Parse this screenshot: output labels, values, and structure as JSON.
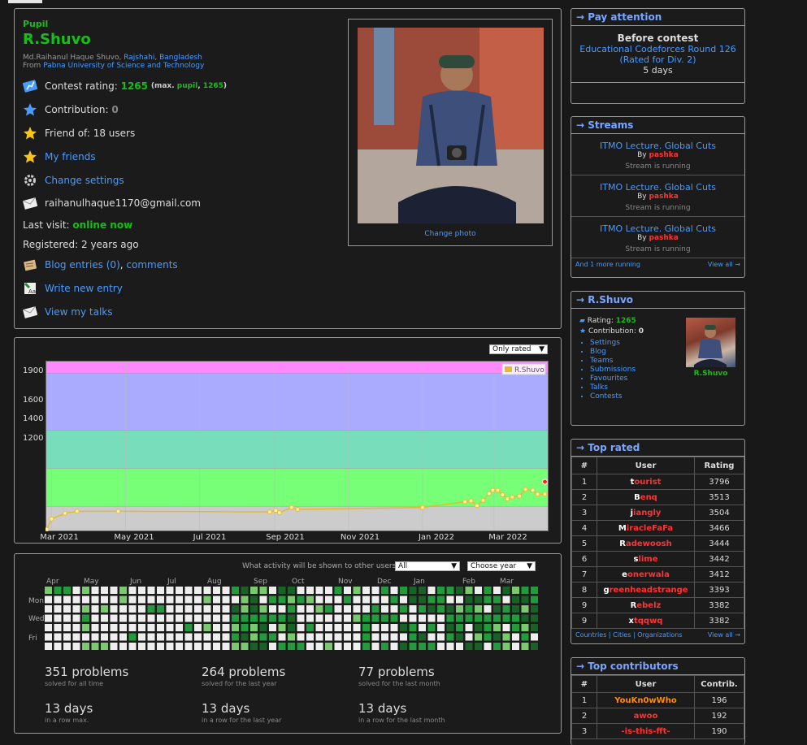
{
  "profile": {
    "rank": "Pupil",
    "handle": "R.Shuvo",
    "fullname_prefix": "Md.Raihanul Haque Shuvo,",
    "city": "Rajshahi",
    "country": "Bangladesh",
    "from_label": "From",
    "organization": "Pabna University of Science and Technology",
    "rating_label": "Contest rating:",
    "rating_value": "1265",
    "rating_max_prefix": "(max.",
    "rating_max_rank": "pupil",
    "rating_max_value": "1265",
    "rating_max_suffix": ")",
    "contribution_label": "Contribution:",
    "contribution_value": "0",
    "friend_of": "Friend of: 18 users",
    "my_friends": "My friends",
    "change_settings": "Change settings",
    "email": "raihanulhaque1170@gmail.com",
    "last_visit_label": "Last visit:",
    "last_visit_value": "online now",
    "registered": "Registered: 2 years ago",
    "blog_entries": "Blog entries (0)",
    "comments": "comments",
    "write_entry": "Write new entry",
    "view_talks": "View my talks",
    "change_photo": "Change photo"
  },
  "graph": {
    "filter": "Only rated",
    "legend": "R.Shuvo"
  },
  "chart_data": {
    "type": "line",
    "series": [
      {
        "name": "R.Shuvo",
        "color": "#e8b930"
      }
    ],
    "x_ticks": [
      "Mar 2021",
      "May 2021",
      "Jul 2021",
      "Sep 2021",
      "Nov 2021",
      "Jan 2022",
      "Mar 2022"
    ],
    "y_ticks": [
      1200,
      1400,
      1600,
      1900
    ],
    "ylim": [
      1070,
      1965
    ],
    "xlim": [
      "2021-02-24",
      "2022-04-15"
    ],
    "bands": [
      {
        "from": 1070,
        "to": 1200,
        "color": "#cccccc"
      },
      {
        "from": 1200,
        "to": 1400,
        "color": "#77ff77"
      },
      {
        "from": 1400,
        "to": 1600,
        "color": "#77ddbb"
      },
      {
        "from": 1600,
        "to": 1900,
        "color": "#aaaaff"
      },
      {
        "from": 1900,
        "to": 1965,
        "color": "#ff88ff"
      }
    ],
    "points": [
      {
        "x": "2021-02-25",
        "y": 1080
      },
      {
        "x": "2021-03-01",
        "y": 1135
      },
      {
        "x": "2021-03-12",
        "y": 1165
      },
      {
        "x": "2021-03-22",
        "y": 1175
      },
      {
        "x": "2021-04-25",
        "y": 1175
      },
      {
        "x": "2021-08-28",
        "y": 1172
      },
      {
        "x": "2021-09-02",
        "y": 1180
      },
      {
        "x": "2021-09-05",
        "y": 1168
      },
      {
        "x": "2021-09-15",
        "y": 1195
      },
      {
        "x": "2021-09-20",
        "y": 1185
      },
      {
        "x": "2022-01-01",
        "y": 1195
      },
      {
        "x": "2022-02-05",
        "y": 1225
      },
      {
        "x": "2022-02-10",
        "y": 1230
      },
      {
        "x": "2022-02-15",
        "y": 1205
      },
      {
        "x": "2022-02-20",
        "y": 1232
      },
      {
        "x": "2022-02-25",
        "y": 1268
      },
      {
        "x": "2022-02-28",
        "y": 1285
      },
      {
        "x": "2022-03-04",
        "y": 1285
      },
      {
        "x": "2022-03-08",
        "y": 1262
      },
      {
        "x": "2022-03-12",
        "y": 1240
      },
      {
        "x": "2022-03-16",
        "y": 1250
      },
      {
        "x": "2022-03-22",
        "y": 1255
      },
      {
        "x": "2022-03-27",
        "y": 1290
      },
      {
        "x": "2022-04-02",
        "y": 1285
      },
      {
        "x": "2022-04-06",
        "y": 1265
      },
      {
        "x": "2022-04-12",
        "y": 1265
      }
    ],
    "last_highlight": {
      "x": "2022-04-12",
      "y": 1330
    }
  },
  "activity": {
    "question": "What activity will be shown to other users:",
    "visibility": "All",
    "year_select": "Choose year",
    "months": [
      "Apr",
      "May",
      "Jun",
      "Jul",
      "Aug",
      "Sep",
      "Oct",
      "Nov",
      "Dec",
      "Jan",
      "Feb",
      "Mar"
    ],
    "days": [
      "Mon",
      "Wed",
      "Fri"
    ],
    "stats": [
      {
        "big": "351 problems",
        "small": "solved for all time"
      },
      {
        "big": "264 problems",
        "small": "solved for the last year"
      },
      {
        "big": "77 problems",
        "small": "solved for the last month"
      },
      {
        "big": "13 days",
        "small": "in a row max."
      },
      {
        "big": "13 days",
        "small": "in a row for the last year"
      },
      {
        "big": "13 days",
        "small": "in a row for the last month"
      }
    ]
  },
  "pay_attention": {
    "title": "→ Pay attention",
    "heading": "Before contest",
    "contest": "Educational Codeforces Round 126 (Rated for Div. 2)",
    "days": "5 days"
  },
  "streams": {
    "title": "→ Streams",
    "items": [
      {
        "title": "ITMO Lecture. Global Cuts",
        "by": "By",
        "author": "pashka",
        "status": "Stream is running"
      },
      {
        "title": "ITMO Lecture. Global Cuts",
        "by": "By",
        "author": "pashka",
        "status": "Stream is running"
      },
      {
        "title": "ITMO Lecture. Global Cuts",
        "by": "By",
        "author": "pashka",
        "status": "Stream is running"
      }
    ],
    "more": "And 1 more running",
    "view_all": "View all →"
  },
  "side_profile": {
    "title": "→ R.Shuvo",
    "rating_label": "Rating:",
    "rating_value": "1265",
    "contribution_label": "Contribution:",
    "contribution_value": "0",
    "links": [
      "Settings",
      "Blog",
      "Teams",
      "Submissions",
      "Favourites",
      "Talks",
      "Contests"
    ],
    "handle": "R.Shuvo"
  },
  "top_rated": {
    "title": "→ Top rated",
    "headers": [
      "#",
      "User",
      "Rating"
    ],
    "rows": [
      {
        "rank": "1",
        "first": "t",
        "rest": "ourist",
        "rating": "3796"
      },
      {
        "rank": "2",
        "first": "B",
        "rest": "enq",
        "rating": "3513"
      },
      {
        "rank": "3",
        "first": "j",
        "rest": "iangly",
        "rating": "3504"
      },
      {
        "rank": "4",
        "first": "M",
        "rest": "iracleFaFa",
        "rating": "3466"
      },
      {
        "rank": "5",
        "first": "R",
        "rest": "adewoosh",
        "rating": "3444"
      },
      {
        "rank": "6",
        "first": "s",
        "rest": "lime",
        "rating": "3442"
      },
      {
        "rank": "7",
        "first": "e",
        "rest": "onerwala",
        "rating": "3412"
      },
      {
        "rank": "8",
        "first": "g",
        "rest": "reenheadstrange",
        "rating": "3393"
      },
      {
        "rank": "9",
        "first": "R",
        "rest": "ebelz",
        "rating": "3382"
      },
      {
        "rank": "9",
        "first": "x",
        "rest": "tqqwq",
        "rating": "3382"
      }
    ],
    "countries": "Countries",
    "cities": "Cities",
    "organizations": "Organizations",
    "view_all": "View all →"
  },
  "top_contributors": {
    "title": "→ Top contributors",
    "headers": [
      "#",
      "User",
      "Contrib."
    ],
    "rows": [
      {
        "rank": "1",
        "user": "YouKn0wWho",
        "contrib": "196",
        "color": "orange"
      },
      {
        "rank": "2",
        "user": "awoo",
        "contrib": "192",
        "color": "red"
      },
      {
        "rank": "3",
        "user": "-is-this-fft-",
        "contrib": "190",
        "color": "red"
      }
    ]
  }
}
